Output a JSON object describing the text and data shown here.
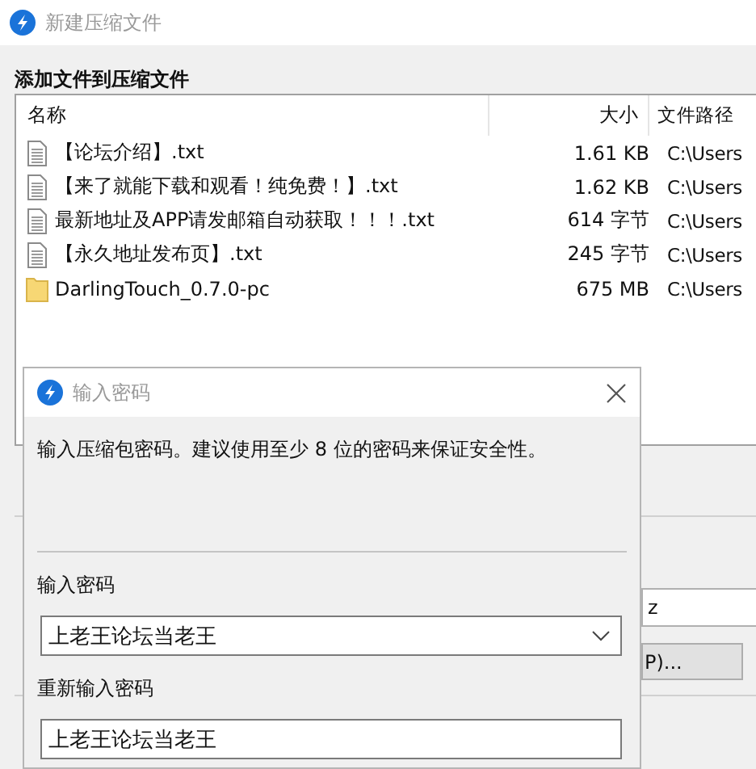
{
  "window": {
    "title": "新建压缩文件"
  },
  "heading": "添加文件到压缩文件",
  "file_list": {
    "columns": [
      "名称",
      "大小",
      "文件路径"
    ],
    "rows": [
      {
        "kind": "file",
        "name": "【论坛介绍】.txt",
        "size": "1.61 KB",
        "path": "C:\\Users"
      },
      {
        "kind": "file",
        "name": "【来了就能下载和观看！纯免费！】.txt",
        "size": "1.62 KB",
        "path": "C:\\Users"
      },
      {
        "kind": "file",
        "name": "最新地址及APP请发邮箱自动获取！！！.txt",
        "size": "614 字节",
        "path": "C:\\Users"
      },
      {
        "kind": "file",
        "name": "【永久地址发布页】.txt",
        "size": "245 字节",
        "path": "C:\\Users"
      },
      {
        "kind": "folder",
        "name": "DarlingTouch_0.7.0-pc",
        "size": "675 MB",
        "path": "C:\\Users"
      }
    ]
  },
  "behind": {
    "field_value": "z",
    "button": "P)..."
  },
  "dialog": {
    "title": "输入密码",
    "message": "输入压缩包密码。建议使用至少 8 位的密码来保证安全性。",
    "password_label": "输入密码",
    "password_value": "上老王论坛当老王",
    "confirm_label": "重新输入密码",
    "confirm_value": "上老王论坛当老王"
  }
}
